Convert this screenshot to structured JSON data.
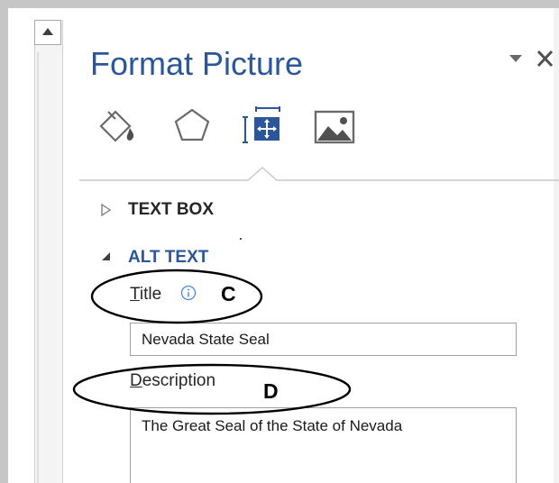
{
  "pane": {
    "title": "Format Picture",
    "menu_icon": "dropdown-triangle-icon",
    "close_icon": "close-x-icon"
  },
  "tabs": [
    {
      "icon": "paint-bucket-icon",
      "selected": false
    },
    {
      "icon": "pentagon-icon",
      "selected": false
    },
    {
      "icon": "size-properties-icon",
      "selected": true
    },
    {
      "icon": "picture-icon",
      "selected": false
    }
  ],
  "sections": {
    "text_box": {
      "label": "TEXT BOX",
      "expanded": false
    },
    "alt_text": {
      "label": "ALT TEXT",
      "expanded": true
    }
  },
  "fields": {
    "title": {
      "access_key": "T",
      "label_rest": "itle",
      "info_icon": "info-icon",
      "value": "Nevada State Seal"
    },
    "description": {
      "access_key": "D",
      "label_rest": "escription",
      "value": "The Great Seal of the State of Nevada"
    }
  },
  "annotations": {
    "title_callout": "C",
    "description_callout": "D"
  },
  "colors": {
    "accent": "#2b579a",
    "header_text": "#262626",
    "info_icon": "#4a86e8",
    "border": "#a0a0a0"
  }
}
